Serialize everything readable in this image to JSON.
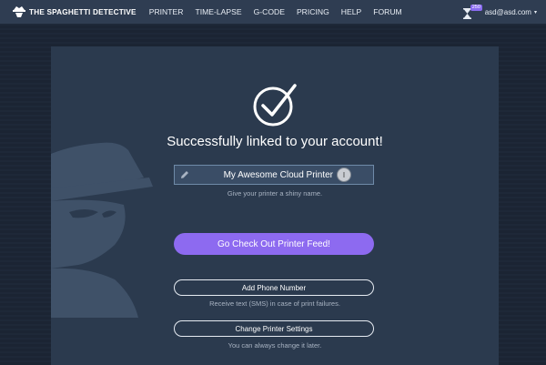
{
  "navbar": {
    "brand": "THE SPAGHETTI DETECTIVE",
    "links": [
      "PRINTER",
      "TIME-LAPSE",
      "G-CODE",
      "PRICING",
      "HELP",
      "FORUM"
    ],
    "badge_count": "250",
    "user_email": "asd@asd.com",
    "caret": "▾"
  },
  "main": {
    "title": "Successfully linked to your account!",
    "printer_name": "My Awesome Cloud Printer",
    "name_hint": "Give your printer a shiny name.",
    "feed_button": "Go Check Out Printer Feed!",
    "phone_button": "Add Phone Number",
    "phone_hint": "Receive text (SMS) in case of print failures.",
    "settings_button": "Change Printer Settings",
    "settings_hint": "You can always change it later."
  },
  "icons": {
    "brand": "detective-logo-icon",
    "hourglass": "hourglass-icon",
    "success": "checkmark-circle-icon",
    "edit": "pencil-icon",
    "cursor": "text-cursor-icon"
  },
  "colors": {
    "navbar": "#2f3d52",
    "card": "#2b3a4e",
    "primary": "#8d6af0",
    "background": "#1b2433"
  }
}
